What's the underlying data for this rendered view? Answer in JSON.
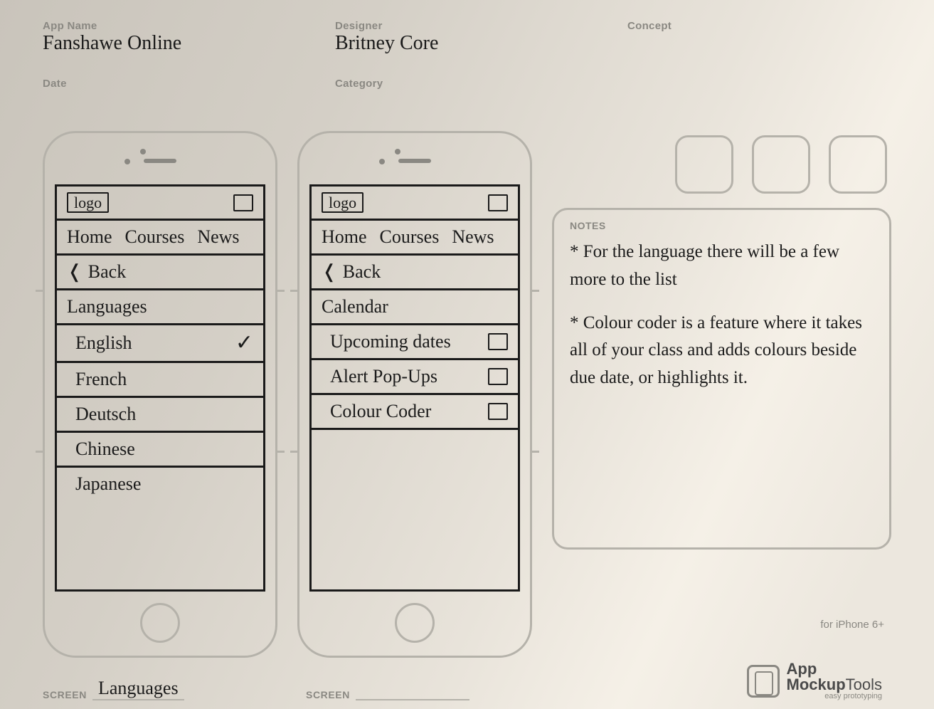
{
  "header": {
    "labels": {
      "app_name": "App Name",
      "designer": "Designer",
      "concept": "Concept",
      "date": "Date",
      "category": "Category"
    },
    "values": {
      "app_name": "Fanshawe Online",
      "designer": "Britney Core",
      "concept": "",
      "date": "",
      "category": ""
    }
  },
  "phone1": {
    "logo": "logo",
    "nav": [
      "Home",
      "Courses",
      "News"
    ],
    "back": "Back",
    "title": "Languages",
    "languages": [
      {
        "name": "English",
        "selected": true
      },
      {
        "name": "French",
        "selected": false
      },
      {
        "name": "Deutsch",
        "selected": false
      },
      {
        "name": "Chinese",
        "selected": false
      },
      {
        "name": "Japanese",
        "selected": false
      }
    ],
    "screen_label": "SCREEN",
    "screen_name": "Languages"
  },
  "phone2": {
    "logo": "logo",
    "nav": [
      "Home",
      "Courses",
      "News"
    ],
    "back": "Back",
    "title": "Calendar",
    "options": [
      {
        "name": "Upcoming dates",
        "toggle": true
      },
      {
        "name": "Alert Pop-Ups",
        "toggle": true
      },
      {
        "name": "Colour Coder",
        "toggle": true
      }
    ],
    "screen_label": "SCREEN",
    "screen_name": ""
  },
  "notes": {
    "label": "NOTES",
    "items": [
      "* For the language there will be a few more to the list",
      "* Colour coder is a feature where it takes all of your class and adds colours beside due date, or highlights it."
    ]
  },
  "footer": {
    "for": "for iPhone 6+",
    "brand1": "App",
    "brand2a": "Mockup",
    "brand2b": "Tools",
    "tag": "easy prototyping"
  }
}
